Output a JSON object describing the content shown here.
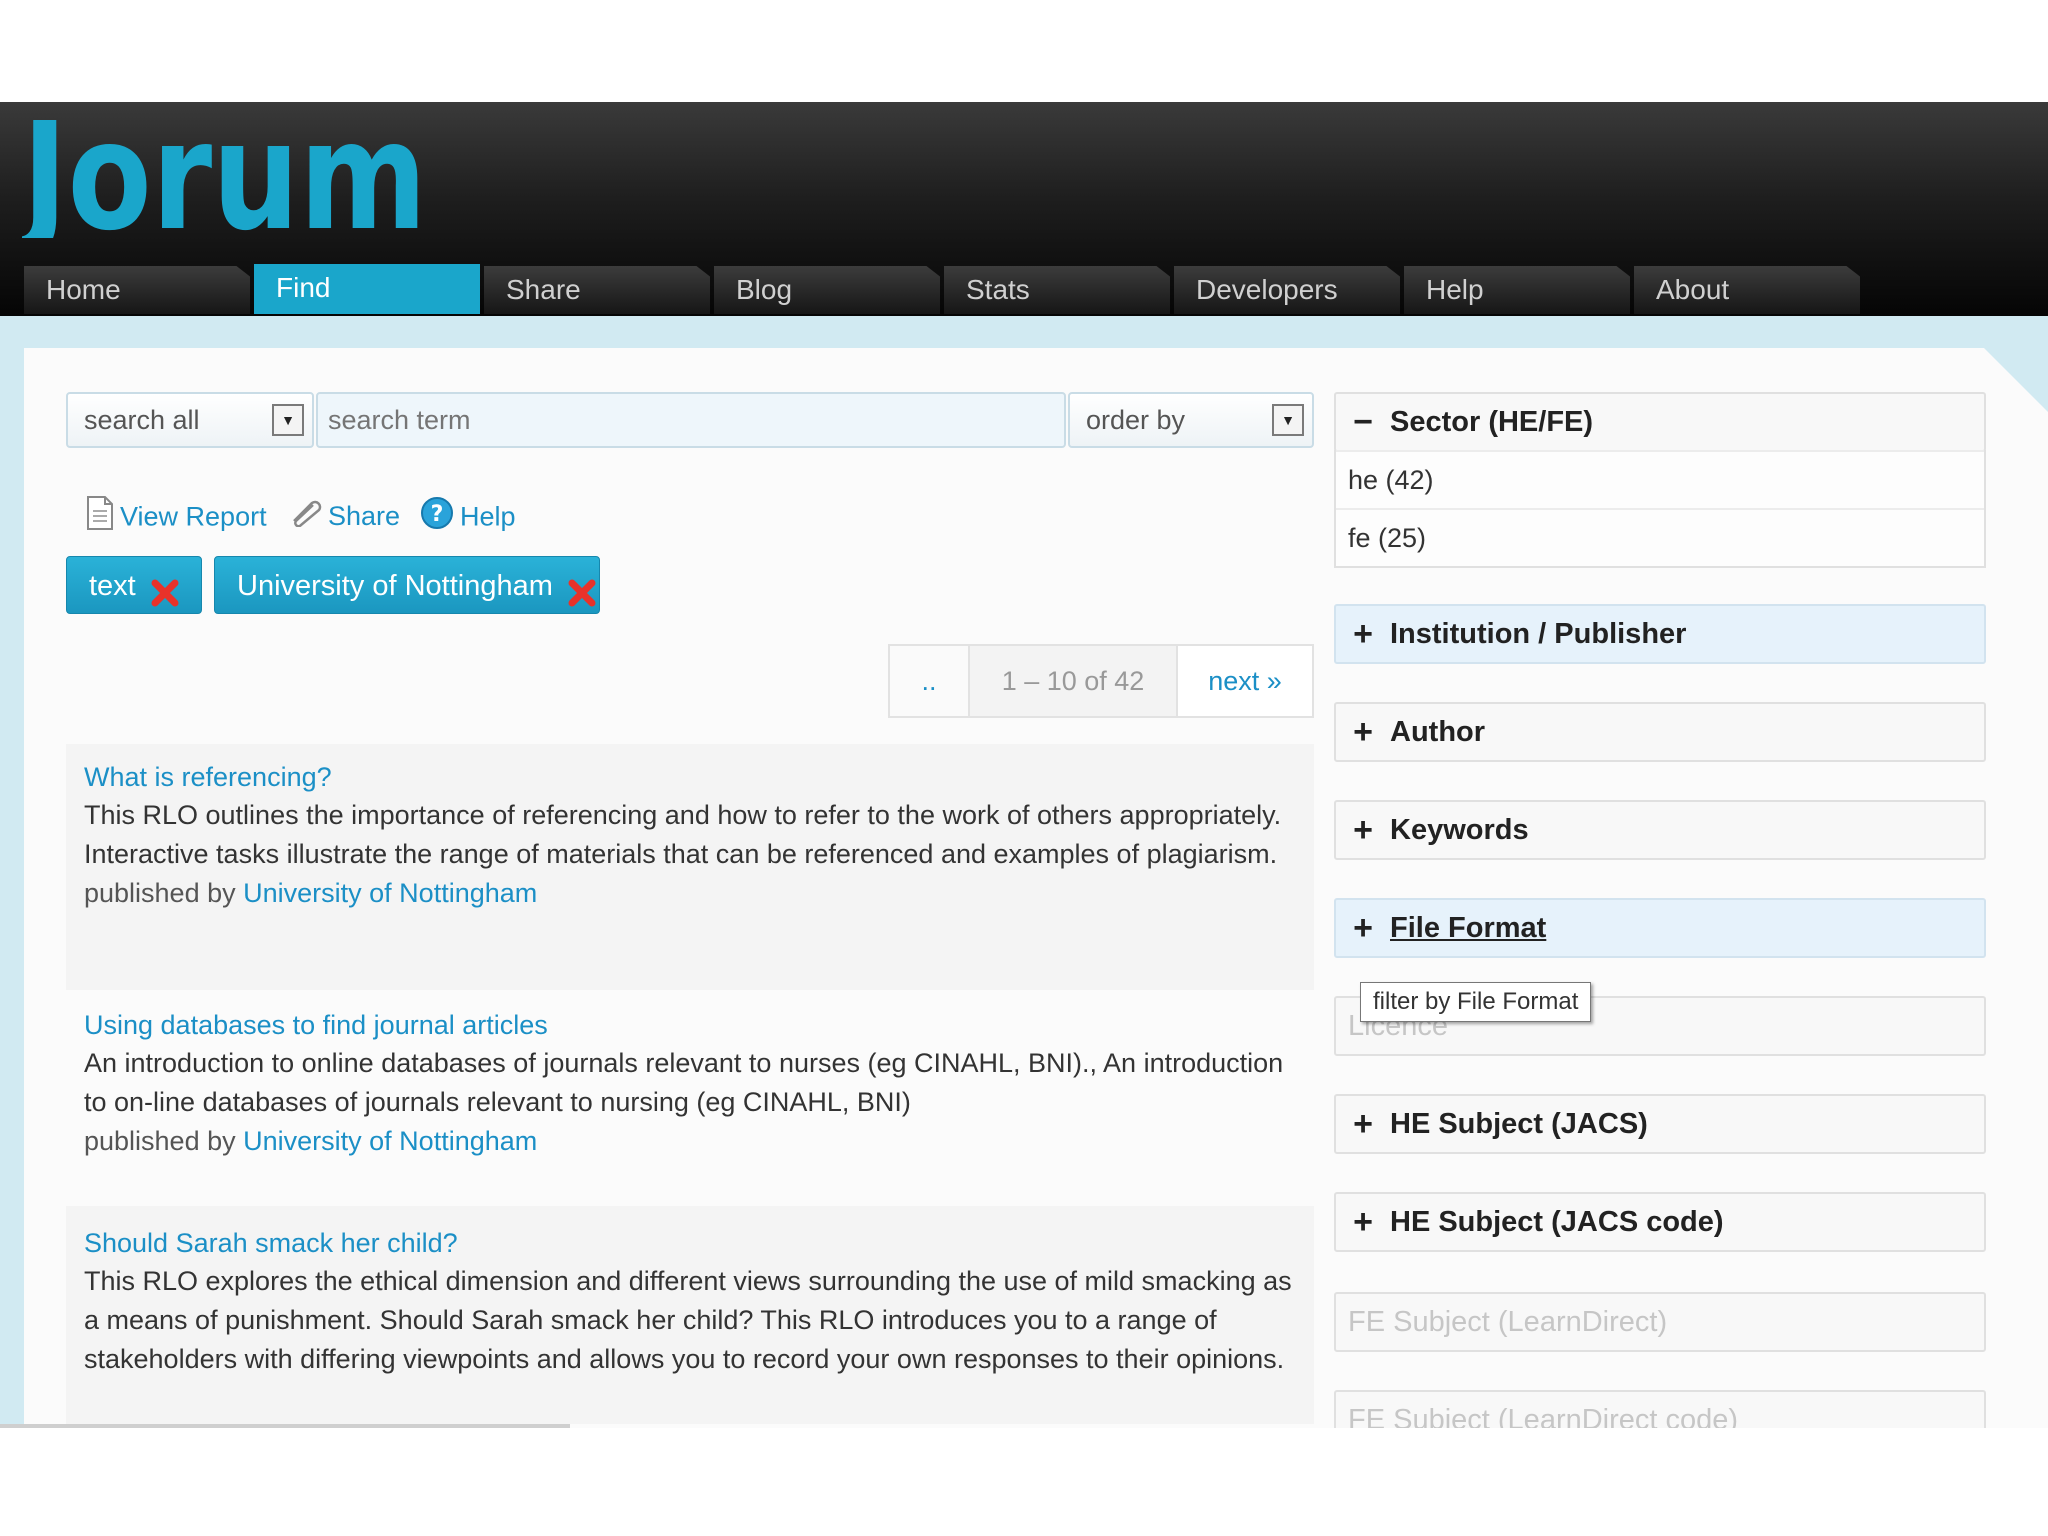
{
  "header": {
    "logo_text": "Jorum",
    "nav": [
      {
        "label": "Home"
      },
      {
        "label": "Find",
        "active": true
      },
      {
        "label": "Share"
      },
      {
        "label": "Blog"
      },
      {
        "label": "Stats"
      },
      {
        "label": "Developers"
      },
      {
        "label": "Help"
      },
      {
        "label": "About"
      }
    ]
  },
  "search": {
    "scope_value": "search all",
    "term_placeholder": "search term",
    "order_value": "order by"
  },
  "tools": {
    "view_report": "View Report",
    "share": "Share",
    "help": "Help"
  },
  "filters": [
    {
      "label": "text"
    },
    {
      "label": "University of Nottingham"
    }
  ],
  "pager": {
    "prev": "..",
    "range": "1 – 10 of 42",
    "next": "next »"
  },
  "results": [
    {
      "title": "What is referencing?",
      "description": "This RLO outlines the importance of referencing and how to refer to the work of others appropriately. Interactive tasks illustrate the range of materials that can be referenced and examples of plagiarism.",
      "published_by_label": "published by",
      "publisher": "University of Nottingham"
    },
    {
      "title": "Using databases to find journal articles",
      "description": "An introduction to online databases of journals relevant to nurses (eg CINAHL, BNI)., An introduction to on-line databases of journals relevant to nursing (eg CINAHL, BNI)",
      "published_by_label": "published by",
      "publisher": "University of Nottingham"
    },
    {
      "title": "Should Sarah smack her child?",
      "description": "This RLO explores the ethical dimension and different views surrounding the use of mild smacking as a means of punishment. Should Sarah smack her child? This RLO introduces you to a range of stakeholders with differing viewpoints and allows you to record your own responses to their opinions."
    }
  ],
  "facets": {
    "sector": {
      "title": "Sector (HE/FE)",
      "sign": "−",
      "items": [
        "he (42)",
        "fe (25)"
      ]
    },
    "institution": {
      "title": "Institution / Publisher",
      "sign": "+"
    },
    "author": {
      "title": "Author",
      "sign": "+"
    },
    "keywords": {
      "title": "Keywords",
      "sign": "+"
    },
    "file_format": {
      "title": "File Format",
      "sign": "+"
    },
    "licence": {
      "title": "Licence"
    },
    "he_subject": {
      "title": "HE Subject (JACS)",
      "sign": "+"
    },
    "he_subject_code": {
      "title": "HE Subject (JACS code)",
      "sign": "+"
    },
    "fe_subject": {
      "title": "FE Subject (LearnDirect)"
    },
    "fe_subject_code": {
      "title": "FE Subject (LearnDirect code)"
    }
  },
  "tooltip": "filter by File Format",
  "colors": {
    "accent": "#1aa6cb",
    "link": "#1b8fc6",
    "header_bg": "#111111",
    "frame_bg": "#d1eaf2"
  }
}
